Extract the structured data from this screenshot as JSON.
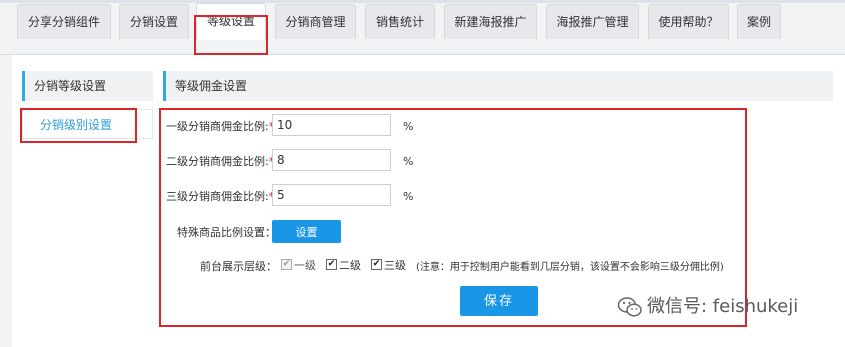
{
  "tabs": [
    {
      "label": "分享分销组件",
      "active": false
    },
    {
      "label": "分销设置",
      "active": false
    },
    {
      "label": "等级设置",
      "active": true
    },
    {
      "label": "分销商管理",
      "active": false
    },
    {
      "label": "销售统计",
      "active": false
    },
    {
      "label": "新建海报推广",
      "active": false
    },
    {
      "label": "海报推广管理",
      "active": false
    },
    {
      "label": "使用帮助？",
      "active": false
    },
    {
      "label": "案例",
      "active": false
    }
  ],
  "sidebar": {
    "heading": "分销等级设置",
    "items": [
      {
        "label": "分销级别设置",
        "active": true
      }
    ]
  },
  "panel": {
    "title": "等级佣金设置",
    "fields": [
      {
        "label": "一级分销商佣金比例:",
        "required_mark": "*",
        "value": "10",
        "unit": "%"
      },
      {
        "label": "二级分销商佣金比例:",
        "required_mark": "*",
        "value": "8",
        "unit": "%"
      },
      {
        "label": "三级分销商佣金比例:",
        "required_mark": "*",
        "value": "5",
        "unit": "%"
      }
    ],
    "special": {
      "label": "特殊商品比例设置：",
      "button_label": "设置"
    },
    "display_levels": {
      "label": "前台展示层级：",
      "options": [
        {
          "label": "一级",
          "checked": true,
          "disabled": true
        },
        {
          "label": "二级",
          "checked": true,
          "disabled": false
        },
        {
          "label": "三级",
          "checked": true,
          "disabled": false
        }
      ],
      "note": "(注意：用于控制用户能看到几层分销，该设置不会影响三级分佣比例)"
    },
    "save_label": "保存"
  },
  "watermark": {
    "text": "微信号: feishukeji",
    "icon": "wechat-icon"
  },
  "colors": {
    "accent": "#1a96e6",
    "highlight_border": "#d9252b",
    "side_accent": "#2eaadc"
  }
}
